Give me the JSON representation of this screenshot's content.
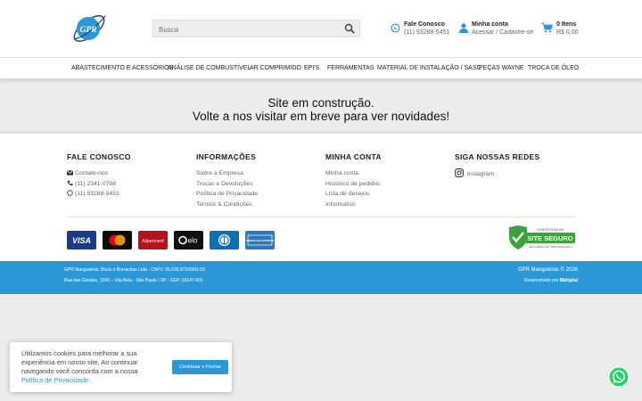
{
  "header": {
    "logo_text": "GPR",
    "search_placeholder": "Busca",
    "contact_title": "Fale Conosco",
    "contact_phone": "(11) 93288-5451",
    "account_title": "Minha conta",
    "account_sub": "Acessar / Cadastre-se",
    "cart_items": "0 Itens",
    "cart_total": "R$ 0,00"
  },
  "nav": [
    "ABASTECIMENTO E ACESSÓRIOS",
    "ANÁLISE DE COMBUSTÍVEL",
    "AR COMPRIMIDO",
    "EPI'S",
    "FERRAMENTAS",
    "MATERIAL DE INSTALAÇÃO / SASC",
    "PEÇAS WAYNE",
    "TROCA DE ÓLEO"
  ],
  "main": {
    "line1": "Site em construção.",
    "line2": "Volte a nos visitar em breve para ver novidades!"
  },
  "footer": {
    "fale": {
      "title": "FALE CONOSCO",
      "email": "Contate-nos",
      "phone": "(11) 2341-0798",
      "whatsapp": "(11) 93288-5451"
    },
    "info": {
      "title": "INFORMAÇÕES",
      "items": [
        "Sobre a Empresa",
        "Trocas e Devoluções",
        "Política de Privacidade",
        "Termos & Condições"
      ]
    },
    "conta": {
      "title": "MINHA CONTA",
      "items": [
        "Minha conta",
        "Histórico de pedidos",
        "Lista de desejos",
        "Informativo"
      ]
    },
    "redes": {
      "title": "SIGA NOSSAS REDES",
      "instagram": "Instagram"
    },
    "payments": {
      "visa": "VISA",
      "hipercard": "Hipercard",
      "elo": "elo",
      "amex": "AMERICAN EXPRESS"
    },
    "seal": {
      "top": "VOCÊ ESTÁ EM UM",
      "main": "SITE SEGURO",
      "bottom": "SEUS DADOS SÃO CRIPTOGRAFADOS"
    }
  },
  "bottom": {
    "company": "GPR Mangueiras, Bicos e Borrachas Ltda - CNPJ: 26.918.972/0001-53",
    "address": "Rua das Giestas, 1090 – Vila Bela - São Paulo / SP - CEP: 03147-001",
    "copyright": "GPR Mangueiras © 2026",
    "dev_prefix": "Desenvolvido por",
    "dev_name": "88digital"
  },
  "cookie": {
    "text": "Utilizamos cookies para melhorar a sua experiência em nosso site. Ao continuar navegando você concorda com a nossa",
    "link": "Política de Privacidade.",
    "button": "Continuar e Fechar"
  },
  "colors": {
    "accent": "#2b97d6",
    "whatsapp": "#25d366"
  }
}
